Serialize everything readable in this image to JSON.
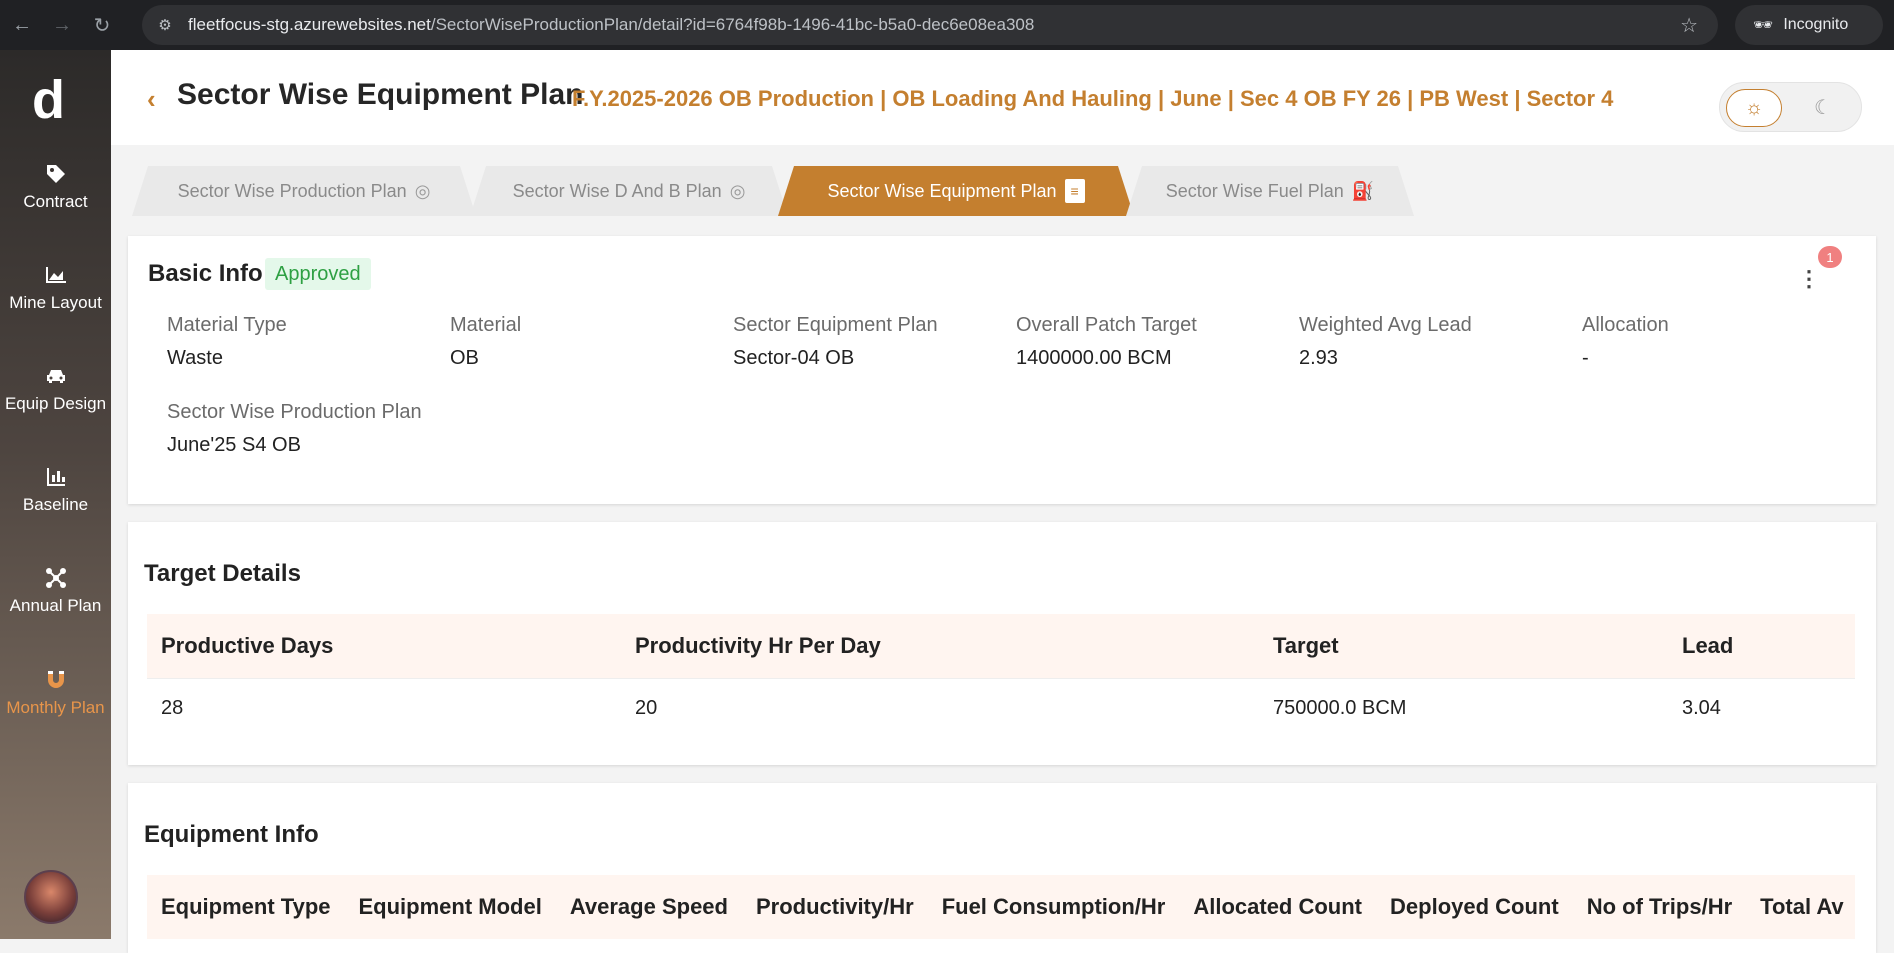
{
  "browser": {
    "url_host": "fleetfocus-stg.azurewebsites.net",
    "url_path": "/SectorWiseProductionPlan/detail?id=6764f98b-1496-41bc-b5a0-dec6e08ea308",
    "incognito_label": "Incognito"
  },
  "sidebar": {
    "logo_letter": "d",
    "items": [
      {
        "label": "Contract",
        "icon": "tag-icon"
      },
      {
        "label": "Mine Layout",
        "icon": "area-chart-icon"
      },
      {
        "label": "Equip Design",
        "icon": "car-icon"
      },
      {
        "label": "Baseline",
        "icon": "bar-chart-icon"
      },
      {
        "label": "Annual Plan",
        "icon": "network-icon"
      },
      {
        "label": "Monthly Plan",
        "icon": "magnet-icon"
      }
    ],
    "active_color": "#e8954a"
  },
  "header": {
    "title": "Sector Wise Equipment Plan",
    "subtitle": "F.Y.2025-2026 OB Production | OB Loading And Hauling | June | Sec 4 OB FY 26 | PB West | Sector 4",
    "accent": "#c47f2f"
  },
  "tabs": [
    {
      "label": "Sector Wise Production Plan",
      "icon": "target-icon"
    },
    {
      "label": "Sector Wise D And B Plan",
      "icon": "target-icon"
    },
    {
      "label": "Sector Wise Equipment Plan",
      "icon": "document-icon"
    },
    {
      "label": "Sector Wise Fuel Plan",
      "icon": "fuel-nozzle-icon"
    }
  ],
  "basic_info": {
    "title": "Basic Info",
    "status": "Approved",
    "notification_count": "1",
    "fields": [
      {
        "label": "Material Type",
        "value": "Waste"
      },
      {
        "label": "Material",
        "value": "OB"
      },
      {
        "label": "Sector Equipment Plan",
        "value": "Sector-04 OB"
      },
      {
        "label": "Overall Patch Target",
        "value": "1400000.00 BCM"
      },
      {
        "label": "Weighted Avg Lead",
        "value": "2.93"
      },
      {
        "label": "Allocation",
        "value": "-"
      },
      {
        "label": "Sector Wise Production Plan",
        "value": "June'25 S4 OB"
      }
    ]
  },
  "target_details": {
    "title": "Target Details",
    "headers": [
      "Productive Days",
      "Productivity Hr Per Day",
      "Target",
      "Lead"
    ],
    "row": [
      "28",
      "20",
      "750000.0 BCM",
      "3.04"
    ]
  },
  "equipment_info": {
    "title": "Equipment Info",
    "headers": [
      "Equipment Type",
      "Equipment Model",
      "Average Speed",
      "Productivity/Hr",
      "Fuel Consumption/Hr",
      "Allocated Count",
      "Deployed Count",
      "No of Trips/Hr",
      "Total Av"
    ]
  }
}
